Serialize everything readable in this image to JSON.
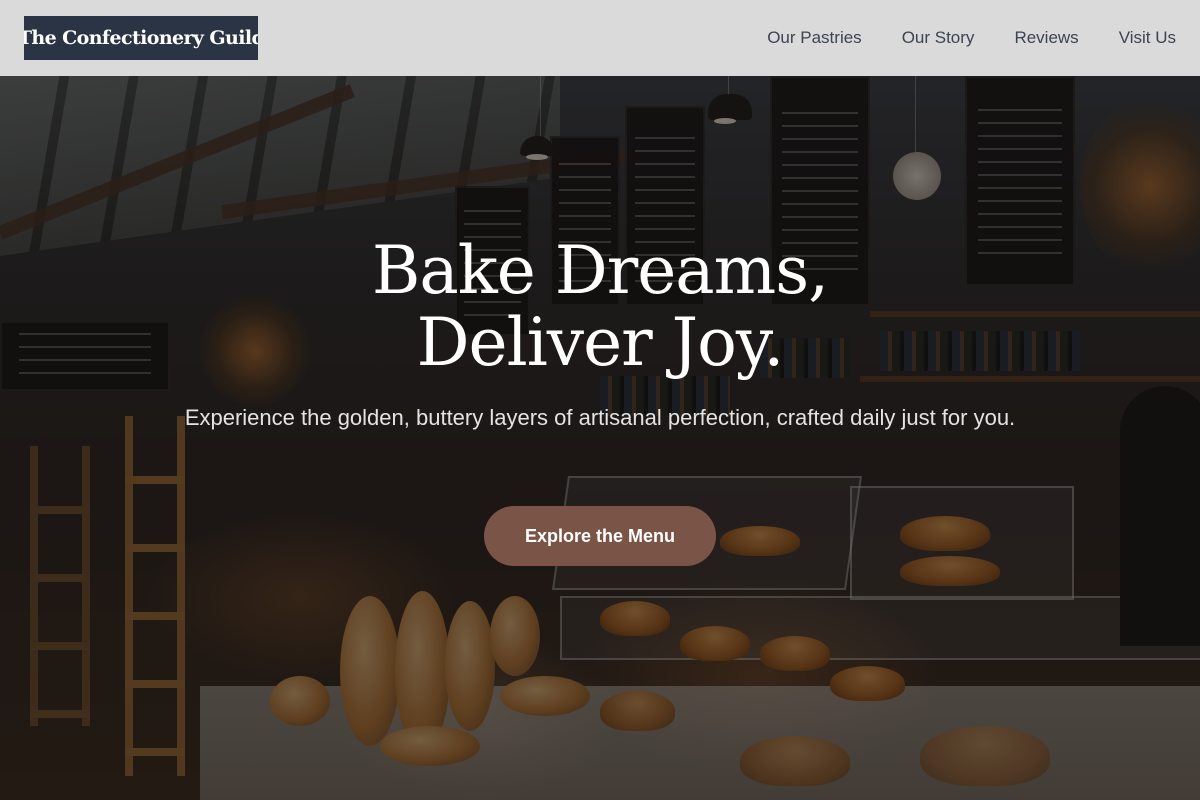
{
  "header": {
    "logo_text": "The Confectionery Guild",
    "nav": [
      {
        "label": "Our Pastries"
      },
      {
        "label": "Our Story"
      },
      {
        "label": "Reviews"
      },
      {
        "label": "Visit Us"
      }
    ]
  },
  "hero": {
    "title_line1": "Bake Dreams,",
    "title_line2": "Deliver Joy.",
    "subtitle": "Experience the golden, buttery layers of artisanal perfection, crafted daily just for you.",
    "cta_label": "Explore the Menu"
  },
  "colors": {
    "logo_bg": "#2b3444",
    "header_bg": "#ececec",
    "nav_text": "#3c4452",
    "cta_bg": "#7a5447",
    "hero_text": "#ffffff"
  }
}
